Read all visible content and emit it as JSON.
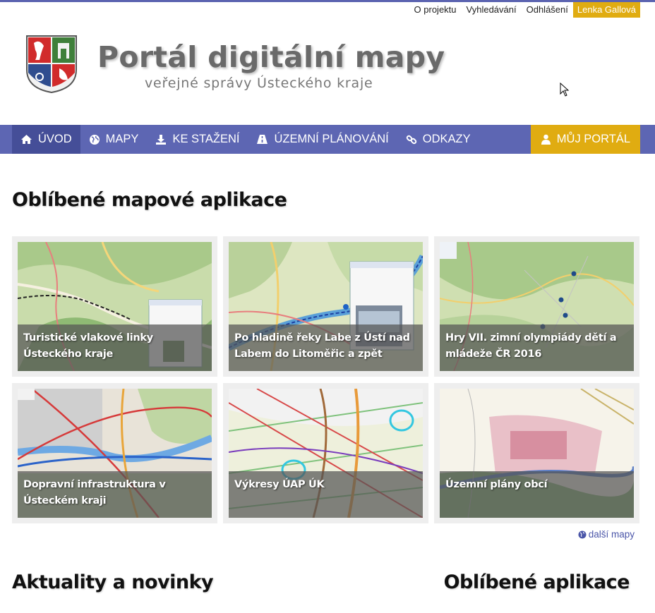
{
  "topbar": {
    "links": [
      "O projektu",
      "Vyhledávání",
      "Odhlášení"
    ],
    "user": "Lenka Gallová"
  },
  "brand": {
    "title": "Portál digitální mapy",
    "subtitle": "veřejné správy Ústeckého kraje",
    "logo_icon": "coat-of-arms-icon"
  },
  "nav": {
    "items": [
      {
        "label": "ÚVOD",
        "icon": "home-icon"
      },
      {
        "label": "MAPY",
        "icon": "globe-icon"
      },
      {
        "label": "KE STAŽENÍ",
        "icon": "download-icon"
      },
      {
        "label": "ÚZEMNÍ PLÁNOVÁNÍ",
        "icon": "road-icon"
      },
      {
        "label": "ODKAZY",
        "icon": "link-icon"
      }
    ],
    "portal": {
      "label": "MŮJ PORTÁL",
      "icon": "user-icon"
    }
  },
  "favorites": {
    "title": "Oblíbené mapové aplikace",
    "tiles": [
      {
        "caption": "Turistické vlakové linky Ústeckého kraje"
      },
      {
        "caption": "Po hladině řeky Labe z Ústí nad Labem do Litoměřic a zpět"
      },
      {
        "caption": "Hry VII. zimní olympiády dětí a mládeže ČR 2016"
      },
      {
        "caption": "Dopravní infrastruktura v Ústeckém kraji"
      },
      {
        "caption": "Výkresy ÚAP ÚK"
      },
      {
        "caption": "Územní plány obcí"
      }
    ],
    "more": "další mapy"
  },
  "news": {
    "title": "Aktuality a novinky"
  },
  "apps": {
    "title": "Oblíbené aplikace"
  },
  "colors": {
    "nav": "#5d66b3",
    "nav_active": "#454e98",
    "accent": "#e0ac11"
  }
}
